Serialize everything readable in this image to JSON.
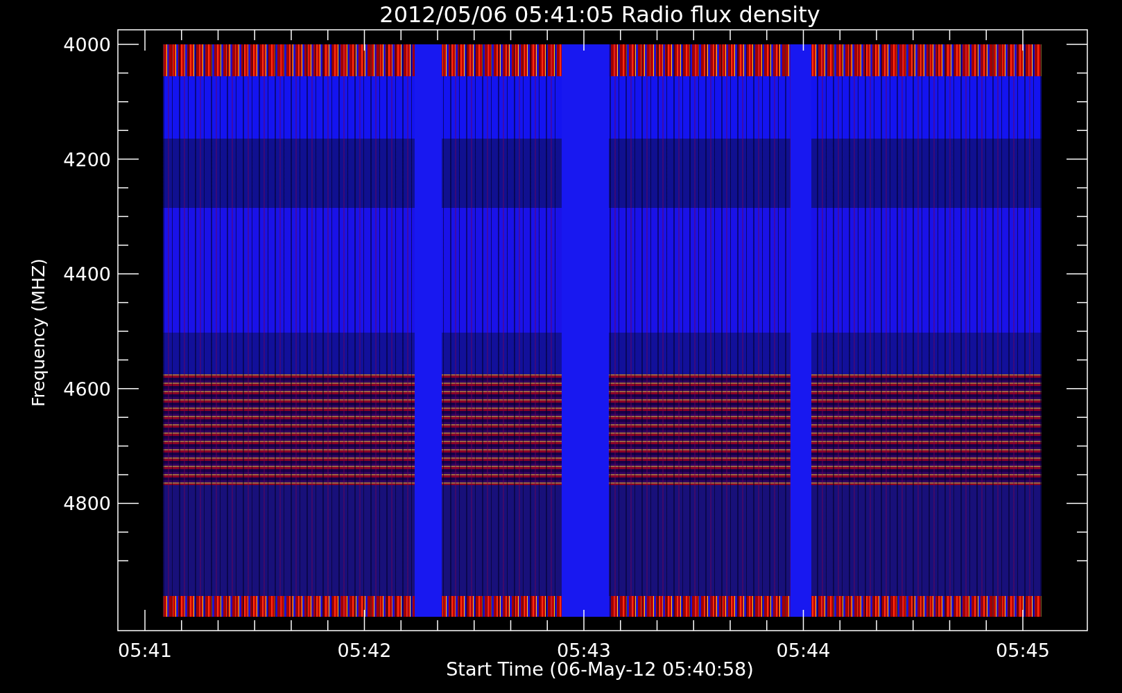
{
  "chart": {
    "title": "2012/05/06 05:41:05 Radio flux density",
    "ylabel": "Frequency (MHZ)",
    "xlabel": "Start Time (06-May-12 05:40:58)",
    "yticks": [
      "4000",
      "4200",
      "4400",
      "4600",
      "4800"
    ],
    "xticks": [
      "05:41",
      "05:42",
      "05:43",
      "05:44",
      "05:45"
    ]
  }
}
